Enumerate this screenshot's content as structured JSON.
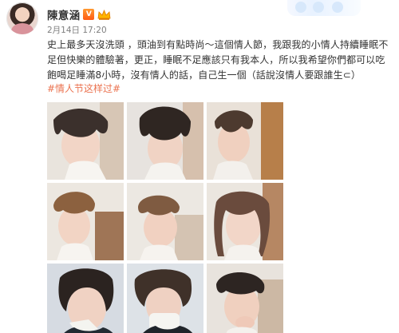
{
  "post": {
    "author": "陳意涵",
    "vip_badge": "V",
    "timestamp": "2月14日 17:20",
    "content": "史上最多天沒洗頭 ，頭油到有點時尚～這個情人節，我跟我的小情人持續睡眠不足但快樂的體驗著，更正，睡眠不足應該只有我本人，所以我希望你們都可以吃飽喝足睡滿8小時，沒有情人的話，自己生一個（話說沒情人要跟誰生⊂）",
    "hashtag": "#情人节这样过#",
    "photos": [
      {
        "icon": "selfie-photo-1"
      },
      {
        "icon": "selfie-photo-2"
      },
      {
        "icon": "selfie-photo-3"
      },
      {
        "icon": "selfie-photo-4"
      },
      {
        "icon": "selfie-photo-5"
      },
      {
        "icon": "selfie-photo-6"
      },
      {
        "icon": "selfie-photo-7"
      },
      {
        "icon": "selfie-photo-8"
      },
      {
        "icon": "selfie-photo-9"
      }
    ]
  },
  "colors": {
    "text": "#333333",
    "muted": "#7f7f7f",
    "link": "#eb7350",
    "vip": "#ff6a1a"
  }
}
